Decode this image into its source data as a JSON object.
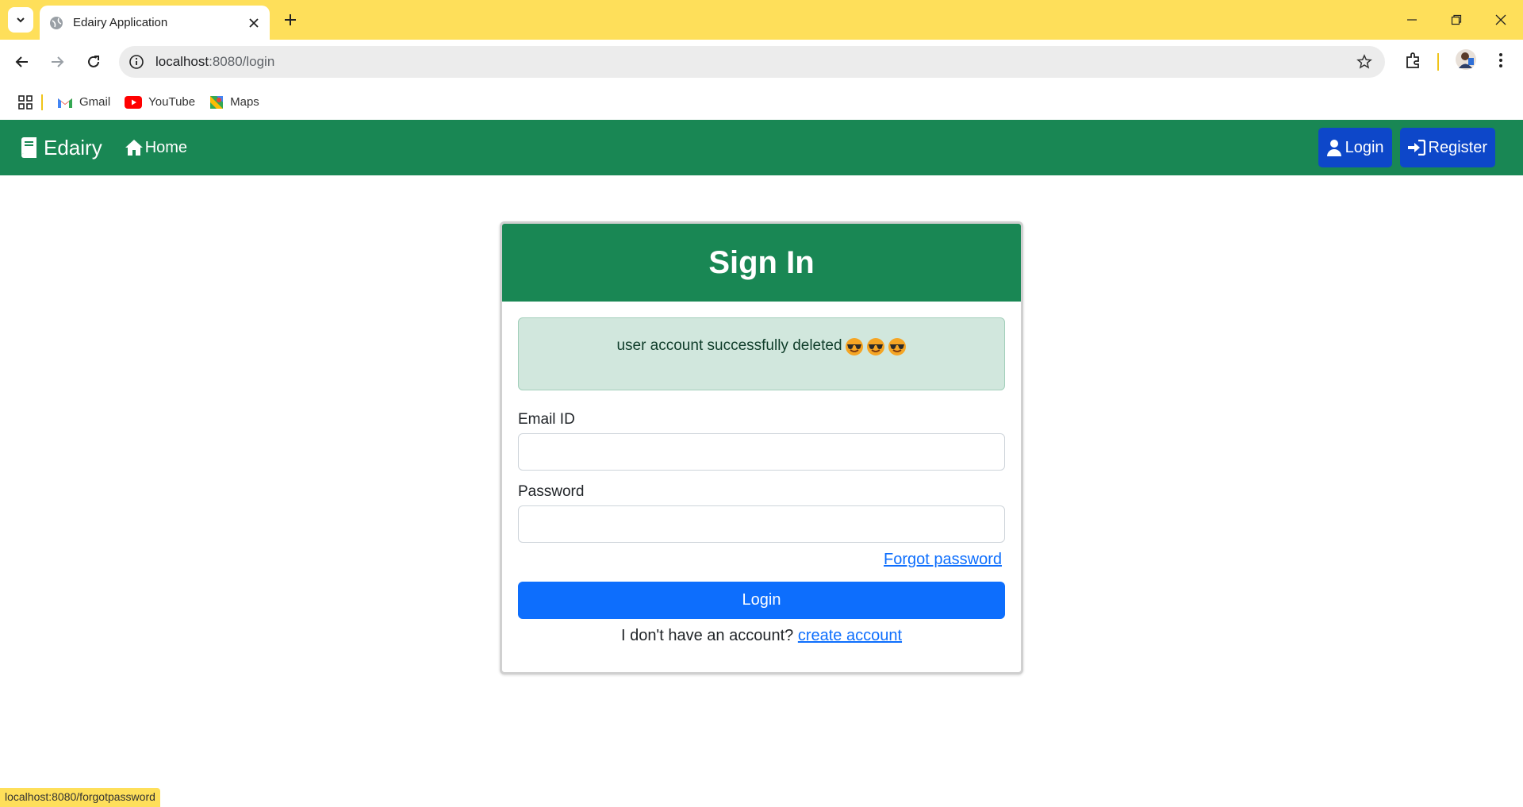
{
  "browser": {
    "tab_title": "Edairy Application",
    "url_host": "localhost",
    "url_path": ":8080/login",
    "bookmarks": [
      {
        "label": "Gmail",
        "icon": "gmail-icon"
      },
      {
        "label": "YouTube",
        "icon": "youtube-icon"
      },
      {
        "label": "Maps",
        "icon": "maps-icon"
      }
    ],
    "status_url": "localhost:8080/forgotpassword"
  },
  "nav": {
    "brand": "Edairy",
    "home": "Home",
    "login": "Login",
    "register": "Register"
  },
  "signin": {
    "title": "Sign In",
    "alert": "user account successfully deleted",
    "email_label": "Email ID",
    "email_value": "",
    "password_label": "Password",
    "password_value": "",
    "forgot": "Forgot password",
    "login_button": "Login",
    "no_account": "I don't have an account?",
    "create_account": "create account"
  },
  "colors": {
    "browser_accent": "#fedf5a",
    "navbar": "#198754",
    "nav_button": "#0d47c9",
    "primary": "#0d6efd",
    "alert_bg": "#d1e7dd"
  }
}
